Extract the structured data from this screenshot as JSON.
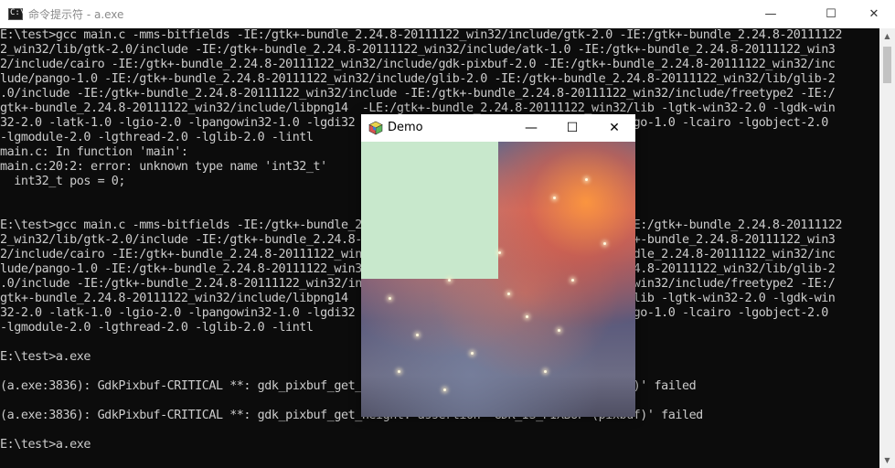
{
  "window": {
    "title": "命令提示符 - a.exe",
    "icon": "console-icon",
    "icon_glyph": "C:\\",
    "minimize_glyph": "—",
    "maximize_glyph": "☐",
    "close_glyph": "✕"
  },
  "console": {
    "lines": [
      "E:\\test>gcc main.c -mms-bitfields -IE:/gtk+-bundle_2.24.8-20111122_win32/include/gtk-2.0 -IE:/gtk+-bundle_2.24.8-20111122",
      "2_win32/lib/gtk-2.0/include -IE:/gtk+-bundle_2.24.8-20111122_win32/include/atk-1.0 -IE:/gtk+-bundle_2.24.8-20111122_win3",
      "2/include/cairo -IE:/gtk+-bundle_2.24.8-20111122_win32/include/gdk-pixbuf-2.0 -IE:/gtk+-bundle_2.24.8-20111122_win32/inc",
      "lude/pango-1.0 -IE:/gtk+-bundle_2.24.8-20111122_win32/include/glib-2.0 -IE:/gtk+-bundle_2.24.8-20111122_win32/lib/glib-2",
      ".0/include -IE:/gtk+-bundle_2.24.8-20111122_win32/include -IE:/gtk+-bundle_2.24.8-20111122_win32/include/freetype2 -IE:/",
      "gtk+-bundle_2.24.8-20111122_win32/include/libpng14  -LE:/gtk+-bundle_2.24.8-20111122_win32/lib -lgtk-win32-2.0 -lgdk-win",
      "32-2.0 -latk-1.0 -lgio-2.0 -lpangowin32-1.0 -lgdi32 -lpangocairo-1.0 -lgdk_pixbuf-2.0 -lpango-1.0 -lcairo -lgobject-2.0",
      "-lgmodule-2.0 -lgthread-2.0 -lglib-2.0 -lintl",
      "main.c: In function 'main':",
      "main.c:20:2: error: unknown type name 'int32_t'",
      "  int32_t pos = 0;",
      "",
      "",
      "E:\\test>gcc main.c -mms-bitfields -IE:/gtk+-bundle_2.24.8-20111122_win32/include/gtk-2.0 -IE:/gtk+-bundle_2.24.8-20111122",
      "2_win32/lib/gtk-2.0/include -IE:/gtk+-bundle_2.24.8-20111122_win32/include/atk-1.0 -IE:/gtk+-bundle_2.24.8-20111122_win3",
      "2/include/cairo -IE:/gtk+-bundle_2.24.8-20111122_win32/include/gdk-pixbuf-2.0 -IE:/gtk+-bundle_2.24.8-20111122_win32/inc",
      "lude/pango-1.0 -IE:/gtk+-bundle_2.24.8-20111122_win32/include/glib-2.0 -IE:/gtk+-bundle_2.24.8-20111122_win32/lib/glib-2",
      ".0/include -IE:/gtk+-bundle_2.24.8-20111122_win32/include -IE:/gtk+-bundle_2.24.8-20111122_win32/include/freetype2 -IE:/",
      "gtk+-bundle_2.24.8-20111122_win32/include/libpng14  -LE:/gtk+-bundle_2.24.8-20111122_win32/lib -lgtk-win32-2.0 -lgdk-win",
      "32-2.0 -latk-1.0 -lgio-2.0 -lpangowin32-1.0 -lgdi32 -lpangocairo-1.0 -lgdk_pixbuf-2.0 -lpango-1.0 -lcairo -lgobject-2.0",
      "-lgmodule-2.0 -lgthread-2.0 -lglib-2.0 -lintl",
      "",
      "E:\\test>a.exe",
      "",
      "(a.exe:3836): GdkPixbuf-CRITICAL **: gdk_pixbuf_get_width: assertion 'GDK_IS_PIXBUF (pixbuf)' failed",
      "",
      "(a.exe:3836): GdkPixbuf-CRITICAL **: gdk_pixbuf_get_height: assertion 'GDK_IS_PIXBUF (pixbuf)' failed",
      "",
      "E:\\test>a.exe"
    ]
  },
  "scrollbar": {
    "up_glyph": "▲",
    "down_glyph": "▼"
  },
  "demo": {
    "title": "Demo",
    "icon": "gtk-icon",
    "minimize_glyph": "—",
    "maximize_glyph": "☐",
    "close_glyph": "✕",
    "green_color": "#c8e8cc"
  }
}
